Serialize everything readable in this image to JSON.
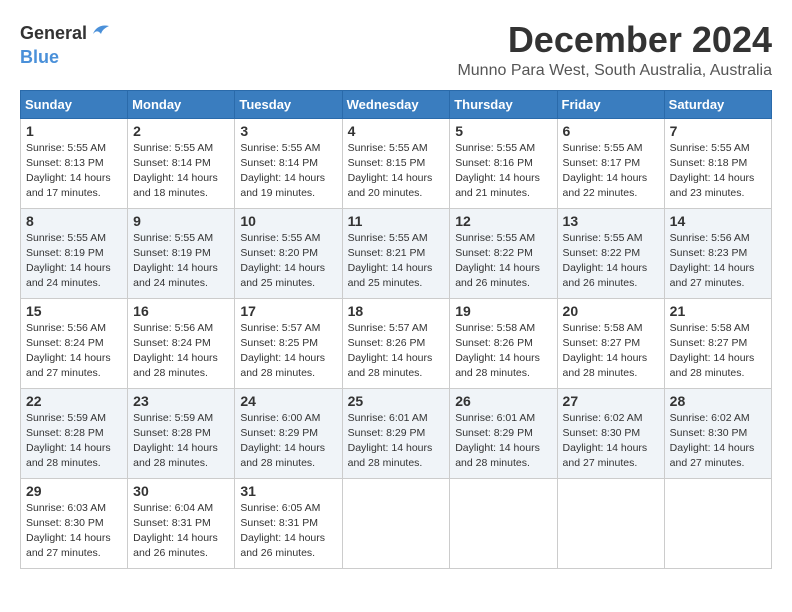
{
  "logo": {
    "general": "General",
    "blue": "Blue"
  },
  "title": "December 2024",
  "location": "Munno Para West, South Australia, Australia",
  "days_of_week": [
    "Sunday",
    "Monday",
    "Tuesday",
    "Wednesday",
    "Thursday",
    "Friday",
    "Saturday"
  ],
  "weeks": [
    [
      {
        "day": "1",
        "sunrise": "5:55 AM",
        "sunset": "8:13 PM",
        "daylight": "14 hours and 17 minutes."
      },
      {
        "day": "2",
        "sunrise": "5:55 AM",
        "sunset": "8:14 PM",
        "daylight": "14 hours and 18 minutes."
      },
      {
        "day": "3",
        "sunrise": "5:55 AM",
        "sunset": "8:14 PM",
        "daylight": "14 hours and 19 minutes."
      },
      {
        "day": "4",
        "sunrise": "5:55 AM",
        "sunset": "8:15 PM",
        "daylight": "14 hours and 20 minutes."
      },
      {
        "day": "5",
        "sunrise": "5:55 AM",
        "sunset": "8:16 PM",
        "daylight": "14 hours and 21 minutes."
      },
      {
        "day": "6",
        "sunrise": "5:55 AM",
        "sunset": "8:17 PM",
        "daylight": "14 hours and 22 minutes."
      },
      {
        "day": "7",
        "sunrise": "5:55 AM",
        "sunset": "8:18 PM",
        "daylight": "14 hours and 23 minutes."
      }
    ],
    [
      {
        "day": "8",
        "sunrise": "5:55 AM",
        "sunset": "8:19 PM",
        "daylight": "14 hours and 24 minutes."
      },
      {
        "day": "9",
        "sunrise": "5:55 AM",
        "sunset": "8:19 PM",
        "daylight": "14 hours and 24 minutes."
      },
      {
        "day": "10",
        "sunrise": "5:55 AM",
        "sunset": "8:20 PM",
        "daylight": "14 hours and 25 minutes."
      },
      {
        "day": "11",
        "sunrise": "5:55 AM",
        "sunset": "8:21 PM",
        "daylight": "14 hours and 25 minutes."
      },
      {
        "day": "12",
        "sunrise": "5:55 AM",
        "sunset": "8:22 PM",
        "daylight": "14 hours and 26 minutes."
      },
      {
        "day": "13",
        "sunrise": "5:55 AM",
        "sunset": "8:22 PM",
        "daylight": "14 hours and 26 minutes."
      },
      {
        "day": "14",
        "sunrise": "5:56 AM",
        "sunset": "8:23 PM",
        "daylight": "14 hours and 27 minutes."
      }
    ],
    [
      {
        "day": "15",
        "sunrise": "5:56 AM",
        "sunset": "8:24 PM",
        "daylight": "14 hours and 27 minutes."
      },
      {
        "day": "16",
        "sunrise": "5:56 AM",
        "sunset": "8:24 PM",
        "daylight": "14 hours and 28 minutes."
      },
      {
        "day": "17",
        "sunrise": "5:57 AM",
        "sunset": "8:25 PM",
        "daylight": "14 hours and 28 minutes."
      },
      {
        "day": "18",
        "sunrise": "5:57 AM",
        "sunset": "8:26 PM",
        "daylight": "14 hours and 28 minutes."
      },
      {
        "day": "19",
        "sunrise": "5:58 AM",
        "sunset": "8:26 PM",
        "daylight": "14 hours and 28 minutes."
      },
      {
        "day": "20",
        "sunrise": "5:58 AM",
        "sunset": "8:27 PM",
        "daylight": "14 hours and 28 minutes."
      },
      {
        "day": "21",
        "sunrise": "5:58 AM",
        "sunset": "8:27 PM",
        "daylight": "14 hours and 28 minutes."
      }
    ],
    [
      {
        "day": "22",
        "sunrise": "5:59 AM",
        "sunset": "8:28 PM",
        "daylight": "14 hours and 28 minutes."
      },
      {
        "day": "23",
        "sunrise": "5:59 AM",
        "sunset": "8:28 PM",
        "daylight": "14 hours and 28 minutes."
      },
      {
        "day": "24",
        "sunrise": "6:00 AM",
        "sunset": "8:29 PM",
        "daylight": "14 hours and 28 minutes."
      },
      {
        "day": "25",
        "sunrise": "6:01 AM",
        "sunset": "8:29 PM",
        "daylight": "14 hours and 28 minutes."
      },
      {
        "day": "26",
        "sunrise": "6:01 AM",
        "sunset": "8:29 PM",
        "daylight": "14 hours and 28 minutes."
      },
      {
        "day": "27",
        "sunrise": "6:02 AM",
        "sunset": "8:30 PM",
        "daylight": "14 hours and 27 minutes."
      },
      {
        "day": "28",
        "sunrise": "6:02 AM",
        "sunset": "8:30 PM",
        "daylight": "14 hours and 27 minutes."
      }
    ],
    [
      {
        "day": "29",
        "sunrise": "6:03 AM",
        "sunset": "8:30 PM",
        "daylight": "14 hours and 27 minutes."
      },
      {
        "day": "30",
        "sunrise": "6:04 AM",
        "sunset": "8:31 PM",
        "daylight": "14 hours and 26 minutes."
      },
      {
        "day": "31",
        "sunrise": "6:05 AM",
        "sunset": "8:31 PM",
        "daylight": "14 hours and 26 minutes."
      },
      null,
      null,
      null,
      null
    ]
  ]
}
